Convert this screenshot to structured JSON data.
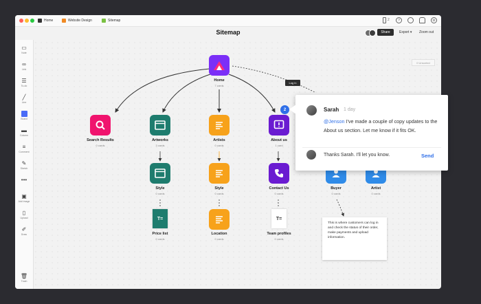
{
  "breadcrumbs": [
    {
      "label": "Home",
      "color": "#333333"
    },
    {
      "label": "Website Design",
      "color": "#f08a24"
    },
    {
      "label": "Sitemap",
      "color": "#7ac143"
    }
  ],
  "topbar_badge": "2",
  "page_title": "Sitemap",
  "header": {
    "share_label": "Share",
    "export_label": "Export ▾",
    "zoom_label": "Zoom out"
  },
  "sidebar": [
    {
      "label": "Note",
      "icon": "note-icon"
    },
    {
      "label": "Link",
      "icon": "link-icon"
    },
    {
      "label": "To-do",
      "icon": "todo-icon"
    },
    {
      "label": "Line",
      "icon": "line-icon"
    },
    {
      "label": "Board",
      "icon": "board-icon"
    },
    {
      "label": "Column",
      "icon": "column-icon"
    },
    {
      "label": "Comment",
      "icon": "comment-icon"
    },
    {
      "label": "Sketch",
      "icon": "sketch-icon"
    },
    {
      "label": "",
      "icon": "more-icon"
    },
    {
      "label": "Add image",
      "icon": "image-icon"
    },
    {
      "label": "Upload",
      "icon": "upload-icon"
    },
    {
      "label": "Draw",
      "icon": "draw-icon"
    },
    {
      "label": "Trash",
      "icon": "trash-icon"
    }
  ],
  "canvas_filter_label": "0 Unsorted",
  "nodes": {
    "home": {
      "label": "Home",
      "sub": "7 cards",
      "color": "#7b2ff7"
    },
    "search": {
      "label": "Search Results",
      "sub": "0 cards",
      "color": "#f0146e"
    },
    "artworks": {
      "label": "Artworks",
      "sub": "3 cards",
      "color": "#1e7c6e"
    },
    "artists": {
      "label": "Artists",
      "sub": "0 cards",
      "color": "#f7a21b"
    },
    "about": {
      "label": "About us",
      "sub": "1 card",
      "color": "#6a1bd1"
    },
    "style1": {
      "label": "Style",
      "sub": "0 cards",
      "color": "#1e7c6e"
    },
    "style2": {
      "label": "Style",
      "sub": "0 cards",
      "color": "#f7a21b"
    },
    "contact": {
      "label": "Contact Us",
      "sub": "0 cards",
      "color": "#6a1bd1"
    },
    "buyer": {
      "label": "Buyer",
      "sub": "0 cards",
      "color": "#2f8be8"
    },
    "artist": {
      "label": "Artist",
      "sub": "0 cards",
      "color": "#2f8be8"
    },
    "price": {
      "label": "Price list",
      "sub": "0 cards",
      "color": "#1e7c6e"
    },
    "location": {
      "label": "Location",
      "sub": "0 cards",
      "color": "#f7a21b"
    },
    "team": {
      "label": "Team profiles",
      "sub": "0 cards",
      "color": "#333333"
    }
  },
  "login_label": "Log in",
  "about_badge": "2",
  "comments": {
    "author": "Sarah",
    "time": "1 day",
    "mention": "@Jenson",
    "text": " I've made a couple of copy updates to the About us section. Let me know if it fits OK.",
    "reply_value": "Thanks Sarah. I'll let you know.",
    "send_label": "Send"
  },
  "note_text": "This is where customers can log in and check the status of their order, make payments and upload information."
}
